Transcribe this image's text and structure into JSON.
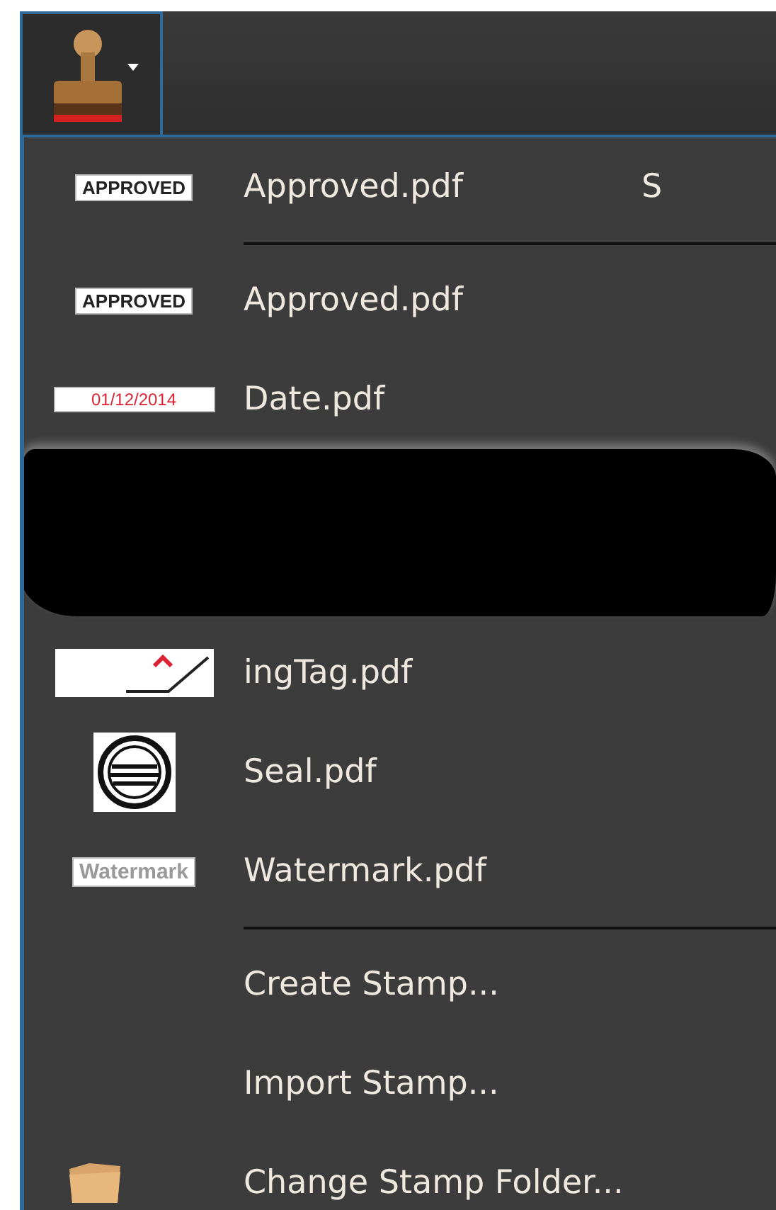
{
  "toolbar": {
    "stamp_button": {
      "expanded": true
    }
  },
  "menu": {
    "items": [
      {
        "kind": "textstamp",
        "icon_text": "APPROVED",
        "label": "Approved.pdf",
        "shortcut": "S"
      },
      {
        "kind": "separator"
      },
      {
        "kind": "textstamp",
        "icon_text": "APPROVED",
        "label": "Approved.pdf"
      },
      {
        "kind": "datestamp",
        "icon_text": "01/12/2014",
        "label": "Date.pdf"
      },
      {
        "kind": "redacted"
      },
      {
        "kind": "tagstamp",
        "label": "ingTag.pdf"
      },
      {
        "kind": "sealstamp",
        "label": "Seal.pdf"
      },
      {
        "kind": "fadedstamp",
        "icon_text": "Watermark",
        "label": "Watermark.pdf"
      },
      {
        "kind": "separator"
      },
      {
        "kind": "command",
        "label": "Create Stamp..."
      },
      {
        "kind": "command",
        "label": "Import Stamp..."
      },
      {
        "kind": "foldercommand",
        "label": "Change Stamp Folder..."
      }
    ]
  }
}
